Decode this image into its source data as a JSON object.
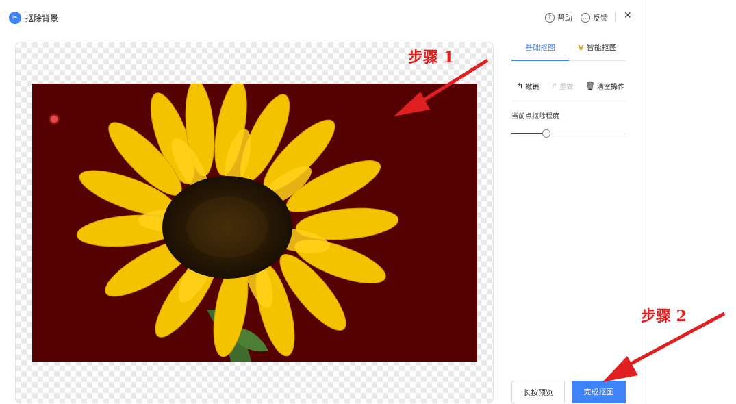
{
  "app": {
    "title": "抠除背景",
    "help_label": "帮助",
    "feedback_label": "反馈",
    "close_icon": "close-icon"
  },
  "panel": {
    "tabs": [
      {
        "label": "基础抠图",
        "active": true
      },
      {
        "label": "智能抠图",
        "badge": "V",
        "active": false
      }
    ],
    "tools": {
      "undo_label": "撤销",
      "redo_label": "重做",
      "clear_label": "清空操作"
    },
    "slider": {
      "label": "当前点抠除程度",
      "value_fraction": 0.3
    }
  },
  "footer": {
    "preview_label": "长按预览",
    "done_label": "完成抠图"
  },
  "annotations": {
    "step1": "步骤 1",
    "step2": "步骤 2"
  },
  "colors": {
    "accent": "#3e83f7",
    "annotation": "#e02020",
    "photo_background": "#560101",
    "petal": "#f5c400"
  }
}
